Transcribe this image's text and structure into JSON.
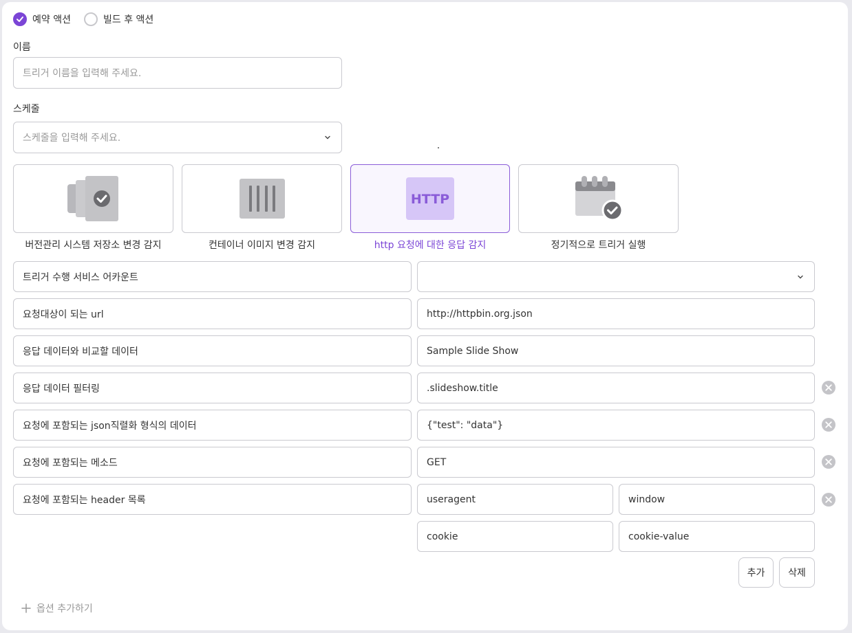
{
  "action_type": {
    "reserved_label": "예약 액션",
    "post_build_label": "빌드 후 액션",
    "selected": "reserved"
  },
  "name": {
    "label": "이름",
    "placeholder": "트리거 이름을 입력해 주세요."
  },
  "schedule": {
    "label": "스케줄",
    "placeholder": "스케줄을 입력해 주세요."
  },
  "trigger_types": [
    {
      "label": "버전관리 시스템 저장소 변경 감지",
      "icon": "vcs-repo-icon",
      "selected": false
    },
    {
      "label": "컨테이너 이미지 변경 감지",
      "icon": "container-image-icon",
      "selected": false
    },
    {
      "label": "http 요청에 대한 응답 감지",
      "icon": "http-icon",
      "icon_text": "HTTP",
      "selected": true
    },
    {
      "label": "정기적으로 트리거 실행",
      "icon": "calendar-check-icon",
      "selected": false
    }
  ],
  "params": {
    "service_account": {
      "label": "트리거 수행 서비스 어카운트",
      "value": ""
    },
    "url": {
      "label": "요청대상이 되는 url",
      "value": "http://httpbin.org.json"
    },
    "compare_data": {
      "label": "응답 데이터와 비교할 데이터",
      "value": "Sample Slide Show"
    },
    "filter": {
      "label": "응답 데이터 필터링",
      "value": ".slideshow.title"
    },
    "json_body": {
      "label": "요청에 포함되는 json직렬화 형식의 데이터",
      "value": "{\"test\": \"data\"}"
    },
    "method": {
      "label": "요청에 포함되는 메소드",
      "value": "GET"
    },
    "headers": {
      "label": "요청에 포함되는 header 목록",
      "rows": [
        {
          "key": "useragent",
          "value": "window"
        },
        {
          "key": "cookie",
          "value": "cookie-value"
        }
      ]
    }
  },
  "buttons": {
    "add": "추가",
    "delete": "삭제"
  },
  "add_option_label": "옵션 추가하기",
  "colors": {
    "accent": "#7b45d6",
    "border": "#c9c9cf",
    "icon_gray": "#b8b8bc",
    "clear_icon": "#c4c4c8"
  }
}
